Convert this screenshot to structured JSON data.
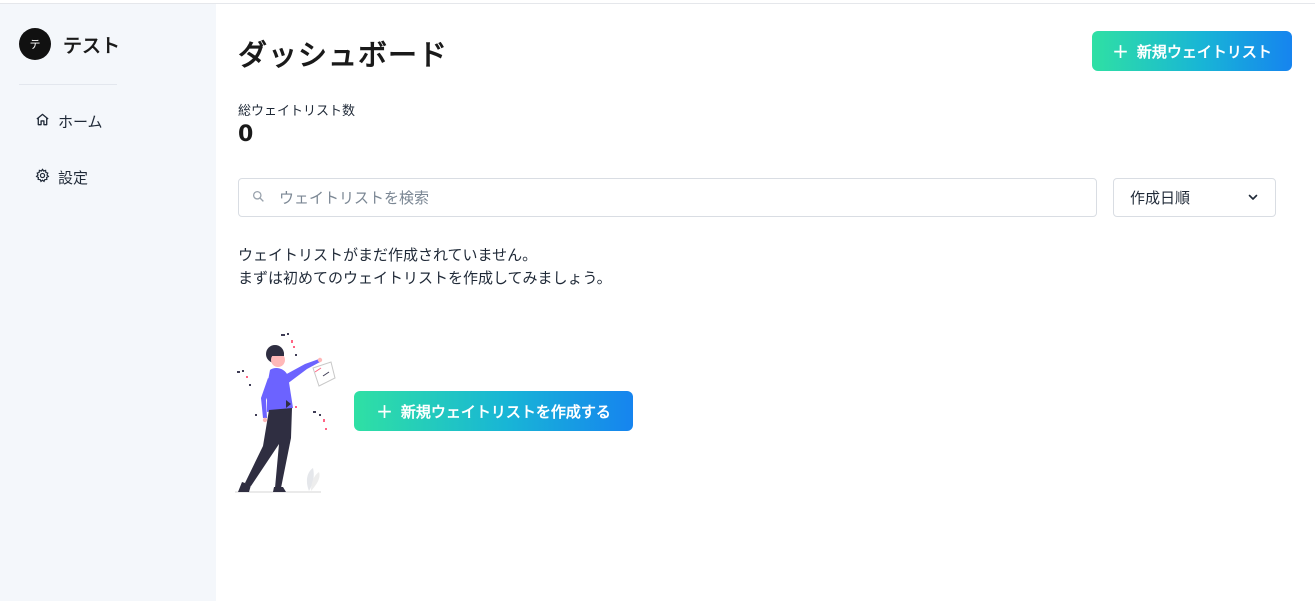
{
  "brand": {
    "avatar_letter": "テ",
    "name": "テスト"
  },
  "sidebar": {
    "items": [
      {
        "label": "ホーム",
        "icon": "home-icon"
      },
      {
        "label": "設定",
        "icon": "gear-icon"
      }
    ]
  },
  "main": {
    "title": "ダッシュボード",
    "new_button_label": "新規ウェイトリスト",
    "stat": {
      "label": "総ウェイトリスト数",
      "value": "0"
    },
    "search": {
      "placeholder": "ウェイトリストを検索",
      "value": ""
    },
    "sort": {
      "selected": "作成日順"
    },
    "empty": {
      "line1": "ウェイトリストがまだ作成されていません。",
      "line2": "まずは初めてのウェイトリストを作成してみましょう。",
      "cta_label": "新規ウェイトリストを作成する"
    }
  },
  "colors": {
    "accent_gradient_start": "#2fe0a4",
    "accent_gradient_end": "#1684ef",
    "sidebar_bg": "#f4f7fb",
    "illustration_shirt": "#6c63ff"
  }
}
